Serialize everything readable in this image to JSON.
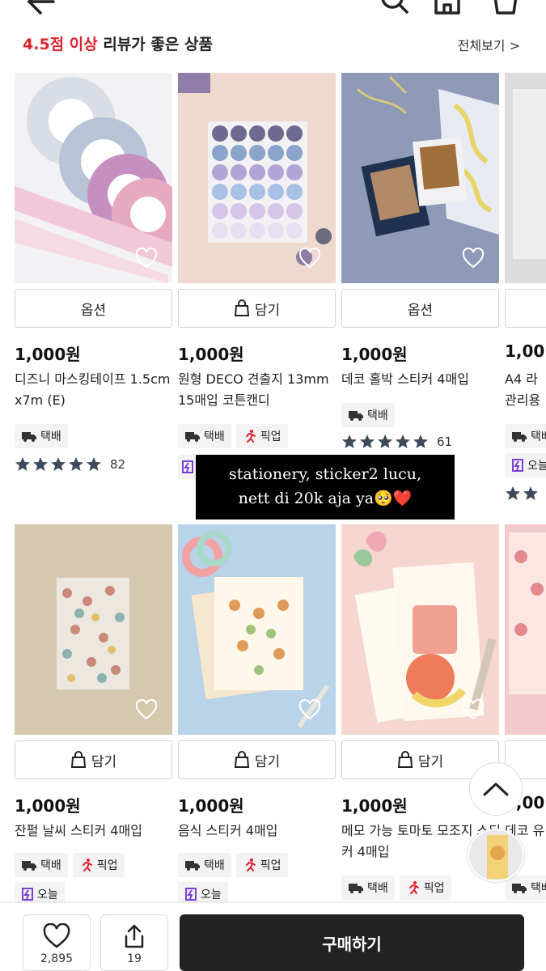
{
  "section": {
    "title_accent": "4.5점 이상",
    "title_rest": " 리뷰가 좋은 상품",
    "see_all": "전체보기 >"
  },
  "row1": [
    {
      "button": "옵션",
      "price": "1,000원",
      "name": "디즈니 마스킹테이프 1.5cmx7m (E)",
      "tags": [
        "택배"
      ],
      "rating_count": "82"
    },
    {
      "button": "담기",
      "price": "1,000원",
      "name": "원형 DECO 견출지 13mm 15매입 코튼캔디",
      "tags": [
        "택배",
        "픽업"
      ],
      "rating_count": ""
    },
    {
      "button": "옵션",
      "price": "1,000원",
      "name": "데코 홀박 스티커 4매입",
      "tags": [
        "택배"
      ],
      "rating_count": "61"
    },
    {
      "button": "",
      "price": "1,00",
      "name": "A4 라 관리용",
      "tags": [
        "택배",
        "오늘"
      ],
      "rating_count": ""
    }
  ],
  "row2": [
    {
      "button": "담기",
      "price": "1,000원",
      "name": "잔펄 날씨 스티커 4매입",
      "tags": [
        "택배",
        "픽업"
      ],
      "tags2": [
        "오늘"
      ]
    },
    {
      "button": "담기",
      "price": "1,000원",
      "name": "음식 스티커 4매입",
      "tags": [
        "택배",
        "픽업"
      ],
      "tags2": [
        "오늘"
      ]
    },
    {
      "button": "담기",
      "price": "1,000원",
      "name": "메모 가능 토마토 모조지 스티커 4매입",
      "tags": [
        "택배",
        "픽업"
      ],
      "tags2": []
    },
    {
      "button": "",
      "price": "1,00",
      "name": "데코 유 이",
      "tags": [
        "택배"
      ],
      "tags2": []
    }
  ],
  "overlay": {
    "line1": "stationery, sticker2 lucu,",
    "line2": "nett di 20k aja ya🥺",
    "heart": "❤️"
  },
  "bottom": {
    "like_count": "2,895",
    "share_count": "19",
    "buy_label": "구매하기"
  },
  "icons": [
    "back-arrow-icon",
    "search-icon",
    "home-icon",
    "cart-icon",
    "heart-icon",
    "bag-icon",
    "truck-icon",
    "pickup-runner-icon",
    "today-icon",
    "star-icon",
    "chevron-up-icon",
    "share-icon"
  ],
  "colors": {
    "accent": "#e0232e",
    "buy_button": "#222222",
    "star": "#3d4a5c",
    "today": "#7a3fd6",
    "pickup": "#e0232e"
  }
}
